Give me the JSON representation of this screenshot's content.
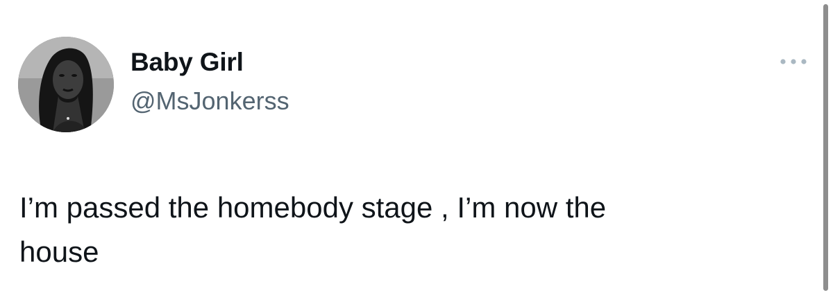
{
  "tweet": {
    "display_name": "Baby Girl",
    "handle": "@MsJonkerss",
    "text": "I’m passed the homebody stage , I’m now the\nhouse"
  },
  "icons": {
    "more": "more-horizontal-icon",
    "avatar": "profile-photo"
  },
  "colors": {
    "text_primary": "#0f1419",
    "text_secondary": "#536471",
    "more_icon": "#aab8c2",
    "scrollbar": "#8e8e8e"
  }
}
